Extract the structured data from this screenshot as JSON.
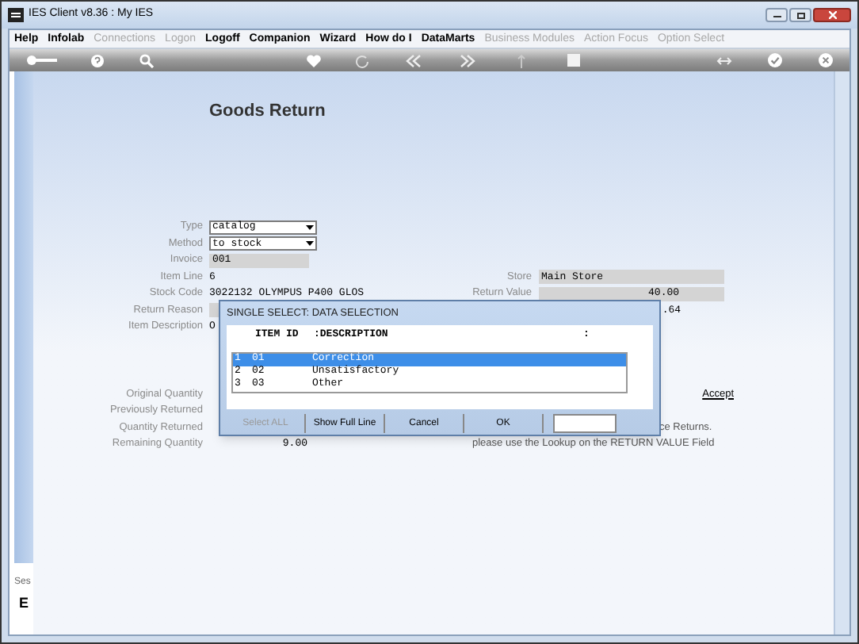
{
  "window": {
    "title": "IES Client v8.36 : My IES"
  },
  "menu": [
    {
      "label": "Help",
      "disabled": false
    },
    {
      "label": "Infolab",
      "disabled": false
    },
    {
      "label": "Connections",
      "disabled": true
    },
    {
      "label": "Logon",
      "disabled": true
    },
    {
      "label": "Logoff",
      "disabled": false
    },
    {
      "label": "Companion",
      "disabled": false
    },
    {
      "label": "Wizard",
      "disabled": false
    },
    {
      "label": "How do I",
      "disabled": false
    },
    {
      "label": "DataMarts",
      "disabled": false
    },
    {
      "label": "Business Modules",
      "disabled": true
    },
    {
      "label": "Action Focus",
      "disabled": true
    },
    {
      "label": "Option Select",
      "disabled": true
    }
  ],
  "sidebar": {
    "texts": [
      "Ses",
      "E"
    ]
  },
  "page_title": "Goods Return",
  "upper_fields": [
    {
      "label": "Type",
      "kind": "select",
      "value": "catalog"
    },
    {
      "label": "Method",
      "kind": "select",
      "value": "to stock"
    },
    {
      "label": "Invoice",
      "kind": "grey",
      "value": "001"
    },
    {
      "label": "Item Line",
      "kind": "plain",
      "value": "6"
    },
    {
      "label": "Stock Code",
      "kind": "plain",
      "value": "3022132 OLYMPUS P400 GLOS"
    },
    {
      "label": "Return Reason",
      "kind": "grey"
    },
    {
      "label": "Item Description",
      "kind": "plain",
      "value": "O"
    }
  ],
  "right_fields": [
    {
      "label": "Store",
      "kind": "grey",
      "value": "Main Store"
    },
    {
      "label": "Return Value",
      "kind": "grey_right",
      "value": "40.00"
    },
    {
      "kind": "plain_right",
      "value": ".64"
    }
  ],
  "lower_fields": [
    {
      "label": "Original Quantity"
    },
    {
      "label": "Previously Returned"
    },
    {
      "label": "Quantity Returned"
    },
    {
      "label": "Remaining Quantity",
      "value": "9.00"
    }
  ],
  "accept_link": "Accept",
  "notes": [
    "ce Returns.",
    "please use the Lookup on the RETURN VALUE Field"
  ],
  "dialog": {
    "title": "SINGLE SELECT: DATA SELECTION",
    "header": [
      "ITEM ID",
      ":DESCRIPTION",
      ":"
    ],
    "rows": [
      {
        "index": "1",
        "id": "01",
        "description": "Correction",
        "selected": true
      },
      {
        "index": "2",
        "id": "02",
        "description": "Unsatisfactory",
        "selected": false
      },
      {
        "index": "3",
        "id": "03",
        "description": "Other",
        "selected": false
      }
    ],
    "buttons": [
      {
        "label": "Select ALL",
        "disabled": true
      },
      {
        "label": "Show Full Line",
        "disabled": false
      },
      {
        "label": "Cancel",
        "disabled": false
      },
      {
        "label": "OK",
        "disabled": false
      }
    ]
  }
}
